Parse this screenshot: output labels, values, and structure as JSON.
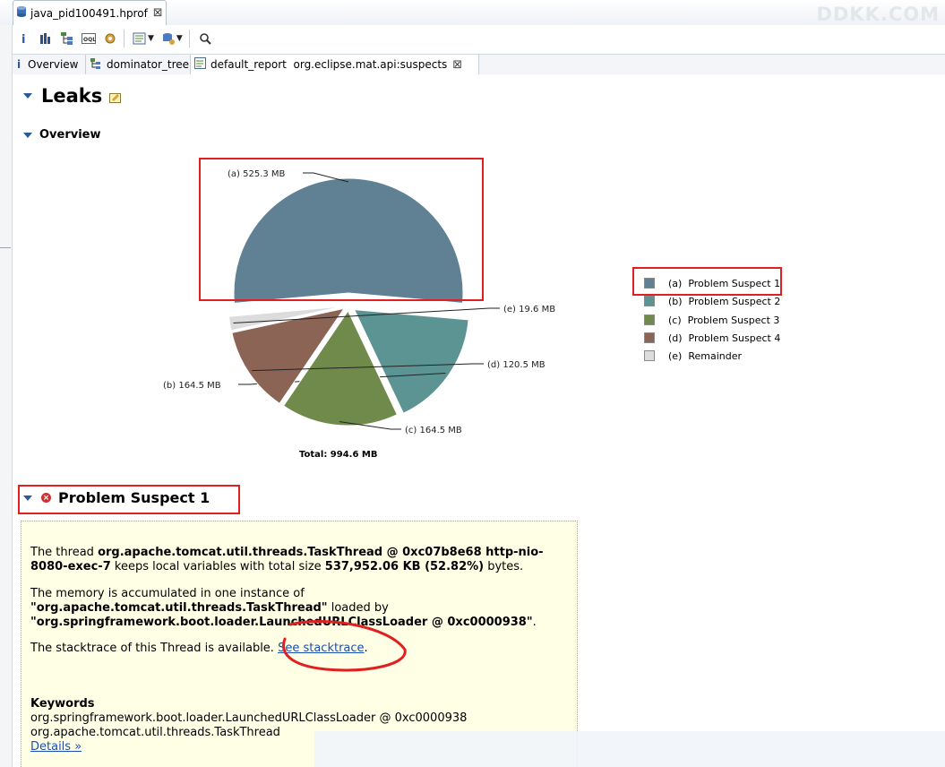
{
  "editor_tab": {
    "title": "java_pid100491.hprof",
    "close": "⊠"
  },
  "watermark": "DDKK.COM",
  "subtabs": [
    {
      "label": "Overview"
    },
    {
      "label": "dominator_tree"
    },
    {
      "label": "default_report  org.eclipse.mat.api:suspects",
      "close": "⊠"
    }
  ],
  "sections": {
    "leaks": "Leaks",
    "overview": "Overview",
    "suspect": "Problem Suspect 1"
  },
  "chart_data": {
    "type": "pie",
    "unit": "MB",
    "slices": [
      {
        "label": "(a)  525.3 MB",
        "legend": "(a)  Problem Suspect 1",
        "value": 525.3,
        "color": "#5f8193"
      },
      {
        "label": "(b)  164.5 MB",
        "legend": "(b)  Problem Suspect 2",
        "value": 164.5,
        "color": "#5c9494"
      },
      {
        "label": "(c)  164.5 MB",
        "legend": "(c)  Problem Suspect 3",
        "value": 164.5,
        "color": "#708a4c"
      },
      {
        "label": "(d)  120.5 MB",
        "legend": "(d)  Problem Suspect 4",
        "value": 120.5,
        "color": "#8c6455"
      },
      {
        "label": "(e)  19.6 MB",
        "legend": "(e)  Remainder",
        "value": 19.6,
        "color": "#dcdcdc"
      }
    ],
    "total_label": "Total: 994.6 MB",
    "legend_position": "right"
  },
  "suspect": {
    "p1": {
      "a": "The thread ",
      "b": "org.apache.tomcat.util.threads.TaskThread @ 0xc07b8e68 http-nio-8080-exec-7",
      "c": " keeps local variables with total size ",
      "d": "537,952.06 KB (52.82%)",
      "e": " bytes."
    },
    "p2": {
      "a": "The memory is accumulated in one instance of",
      "b": "\"org.apache.tomcat.util.threads.TaskThread\"",
      "c": " loaded by",
      "d": "\"org.springframework.boot.loader.LaunchedURLClassLoader @ 0xc0000938\"",
      "e": "."
    },
    "p3": {
      "a": "The stacktrace of this Thread is available. ",
      "link": "See stacktrace",
      "end": "."
    },
    "keywords": {
      "title": "Keywords",
      "k1": "org.springframework.boot.loader.LaunchedURLClassLoader @ 0xc0000938",
      "k2": "org.apache.tomcat.util.threads.TaskThread"
    },
    "details": "Details »"
  }
}
